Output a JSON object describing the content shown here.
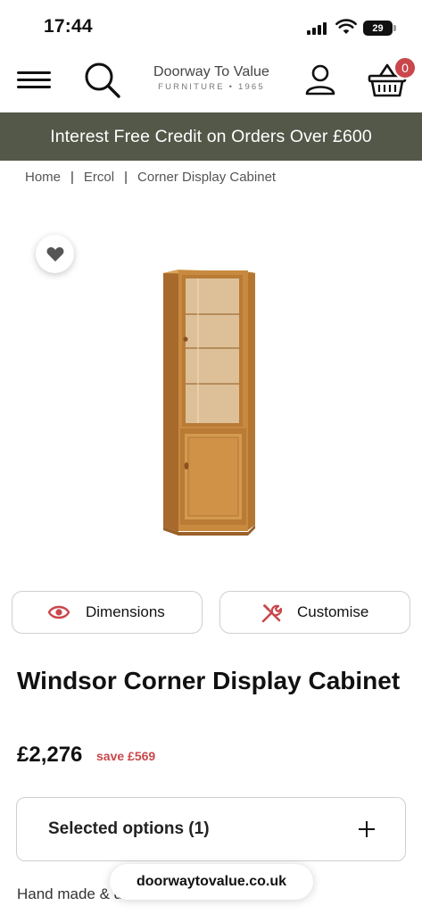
{
  "status_bar": {
    "time": "17:44",
    "battery": "29"
  },
  "header": {
    "logo_name": "Doorway To Value",
    "logo_sub": "FURNITURE • 1965",
    "cart_count": "0",
    "icons": [
      "menu-icon",
      "search-icon",
      "account-icon",
      "basket-icon"
    ]
  },
  "promo": {
    "text": "Interest Free Credit on Orders Over £600"
  },
  "breadcrumb": {
    "items": [
      "Home",
      "Ercol",
      "Corner Display Cabinet"
    ],
    "separator": "|"
  },
  "product": {
    "title": "Windsor Corner Display Cabinet",
    "price": "£2,276",
    "save": "save £569",
    "buttons": {
      "dimensions": "Dimensions",
      "customise": "Customise"
    },
    "options_label": "Selected options (1)",
    "delivery": "Hand made & delivered from 7 - 11 weeks"
  },
  "browser": {
    "url": "doorwaytovalue.co.uk"
  },
  "colors": {
    "promo_bg": "#535849",
    "accent": "#c9474b",
    "wood": "#c88a3f"
  }
}
